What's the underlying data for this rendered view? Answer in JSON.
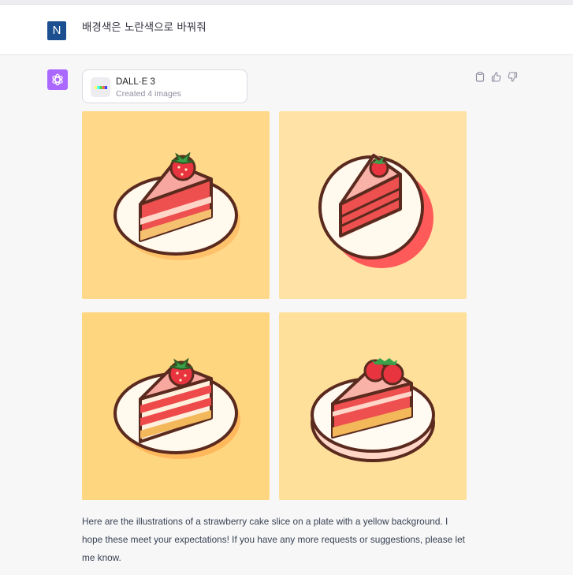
{
  "user_message": {
    "avatar_letter": "N",
    "avatar_color": "#1b4f8f",
    "text": "배경색은 노란색으로 바꿔줘"
  },
  "assistant": {
    "avatar_icon": "openai-logo-icon",
    "avatar_color": "#ab68ff",
    "actions": [
      "clipboard-icon",
      "thumbs-up-icon",
      "thumbs-down-icon"
    ],
    "tool": {
      "title": "DALL·E 3",
      "subtitle": "Created 4 images"
    },
    "images": [
      {
        "subject": "strawberry cake slice on white plate",
        "background": "#ffd88a"
      },
      {
        "subject": "strawberry cake slice on white plate with red shadow",
        "background": "#ffe2a6"
      },
      {
        "subject": "striped strawberry cake slice on white plate",
        "background": "#ffd680"
      },
      {
        "subject": "strawberry cake slice with two strawberries on plate",
        "background": "#ffe09a"
      }
    ],
    "reply": "Here are the illustrations of a strawberry cake slice on a plate with a yellow background. I hope these meet your expectations! If you have any more requests or suggestions, please let me know."
  }
}
